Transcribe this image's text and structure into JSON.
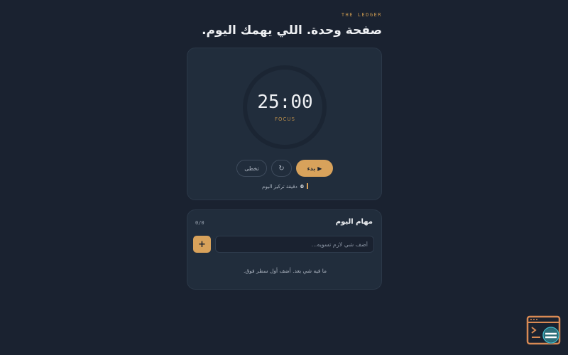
{
  "header": {
    "brand": "THE LEDGER",
    "title": "صفحة وحدة. اللي يهمك اليوم."
  },
  "timer": {
    "time": "25:00",
    "mode": "FOCUS",
    "progress": 0,
    "controls": {
      "skip_label": "تخطى",
      "reset_icon": "↻",
      "start_label": "بدء",
      "play_icon": "▶"
    },
    "stat": {
      "minutes": "0",
      "label": "دقيقة تركيز اليوم"
    }
  },
  "tasks": {
    "title": "مهام اليوم",
    "count": "0/0",
    "input_placeholder": "أضف شي لازم تسويه...",
    "add_label": "+",
    "empty_message": "ما فيه شي بعد. أضف أول سطر فوق."
  },
  "colors": {
    "background": "#1a2230",
    "card": "#212d3c",
    "accent": "#d8a25b"
  },
  "icons": {
    "reset": "reset-icon",
    "play": "play-icon",
    "logo": "app-logo-icon"
  }
}
